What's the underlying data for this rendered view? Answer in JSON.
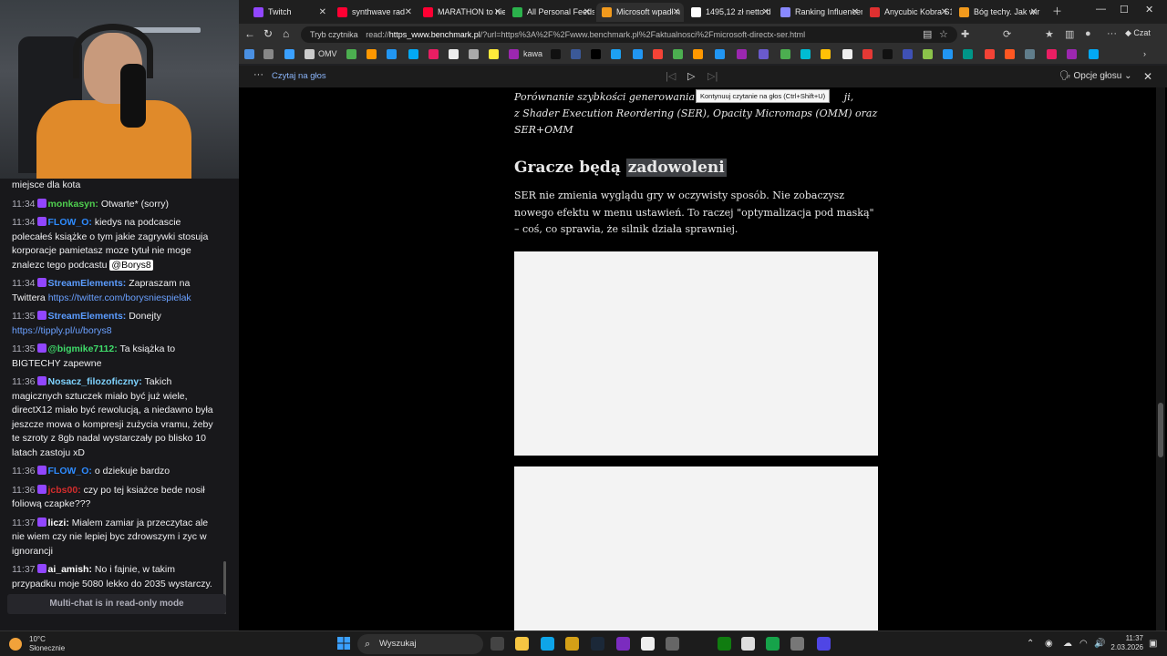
{
  "chat": {
    "messages": [
      {
        "time": "",
        "user": "",
        "text": "miejsce dla kota",
        "user_color": "#ffffff"
      },
      {
        "time": "11:34",
        "user": "monkasyn:",
        "text": "Otwarte* (sorry)",
        "user_color": "#4fcf4f"
      },
      {
        "time": "11:34",
        "user": "FLOW_O:",
        "text": "kiedys na podcascie polecałeś książke o tym jakie zagrywki stosuja korporacje pamietasz moze tytuł nie moge znalezc tego podcastu",
        "mention": "@Borys8",
        "user_color": "#2e8bff"
      },
      {
        "time": "11:34",
        "user": "StreamElements:",
        "text": "Zapraszam na Twittera",
        "link": "https://twitter.com/borysniespielak",
        "user_color": "#5b9cff"
      },
      {
        "time": "11:35",
        "user": "StreamElements:",
        "text": "Donejty",
        "link": "https://tipply.pl/u/borys8",
        "user_color": "#5b9cff"
      },
      {
        "time": "11:35",
        "user": "@bigmike7112:",
        "text": "Ta książka to BIGTECHY zapewne",
        "user_color": "#3fdc6a"
      },
      {
        "time": "11:36",
        "user": "Nosacz_filozoficzny:",
        "text": "Takich magicznych sztuczek miało być już wiele, directX12 miało być rewolucją, a niedawno była jeszcze mowa o kompresji zużycia vramu, żeby te szroty z 8gb nadal wystarczały po blisko 10 latach zastoju xD",
        "user_color": "#7fd3ff"
      },
      {
        "time": "11:36",
        "user": "FLOW_O:",
        "text": "o dziekuje bardzo",
        "user_color": "#2e8bff"
      },
      {
        "time": "11:36",
        "user": "jcbs00:",
        "text": "czy po tej ksiażce bede nosił foliową czapke???",
        "user_color": "#d42d2d"
      },
      {
        "time": "11:37",
        "user": "liczi:",
        "text": "Mialem zamiar ja przeczytac ale nie wiem czy nie lepiej byc zdrowszym i zyc w ignorancji",
        "user_color": "#ffffff"
      },
      {
        "time": "11:37",
        "user": "ai_amish:",
        "text": "No i fajnie, w takim przypadku moje 5080 lekko do 2035 wystarczy.",
        "user_color": "#ffffff"
      }
    ],
    "readonly_label": "Multi-chat is in read-only mode"
  },
  "browser": {
    "tabs": [
      {
        "title": "Twitch",
        "color": "#9146ff",
        "active": false
      },
      {
        "title": "synthwave rad",
        "color": "#ff0033",
        "active": false
      },
      {
        "title": "MARATHON to nie",
        "color": "#ff0033",
        "active": false
      },
      {
        "title": "All Personal Feeds",
        "color": "#2bb24c",
        "active": false
      },
      {
        "title": "Microsoft wpadł n",
        "color": "#f29a1d",
        "active": true
      },
      {
        "title": "1495,12 zł netto d",
        "color": "#ffffff",
        "active": false
      },
      {
        "title": "Ranking Influencer",
        "color": "#8888ff",
        "active": false
      },
      {
        "title": "Anycubic Kobra S1",
        "color": "#e03030",
        "active": false
      },
      {
        "title": "Bóg techy. Jak wir",
        "color": "#f29a1d",
        "active": false
      }
    ],
    "reader_mode_label": "Tryb czytnika",
    "url_prefix": "read://",
    "url_host": "https_www.benchmark.pl",
    "url_rest": "/?url=https%3A%2F%2Fwww.benchmark.pl%2Faktualnosci%2Fmicrosoft-directx-ser.html",
    "copilot_label": "Czat",
    "bookmark_labels": [
      "OMV",
      "kawa"
    ],
    "read_aloud": {
      "label": "Czytaj na głos",
      "tooltip": "Kontynuuj czytanie na głos (Ctrl+Shift+U)",
      "options_label": "Opcje głosu"
    }
  },
  "article": {
    "caption_line1": "Porównanie szybkości generowania kl",
    "caption_line1_end": "ji,",
    "caption_rest": "z Shader Execution Reordering (SER), Opacity Micromaps (OMM) oraz SER+OMM",
    "heading_plain": "Gracze będą",
    "heading_highlight": "zadowoleni",
    "paragraph": "SER nie zmienia wyglądu gry w oczywisty sposób. Nie zobaczysz nowego efektu w menu ustawień. To raczej \"optymalizacja pod maską\" – coś, co sprawia, że silnik działa sprawniej."
  },
  "taskbar": {
    "temperature": "10°C",
    "weather": "Słonecznie",
    "search_placeholder": "Wyszukaj",
    "time": "11:37",
    "date": "2.03.2026"
  }
}
